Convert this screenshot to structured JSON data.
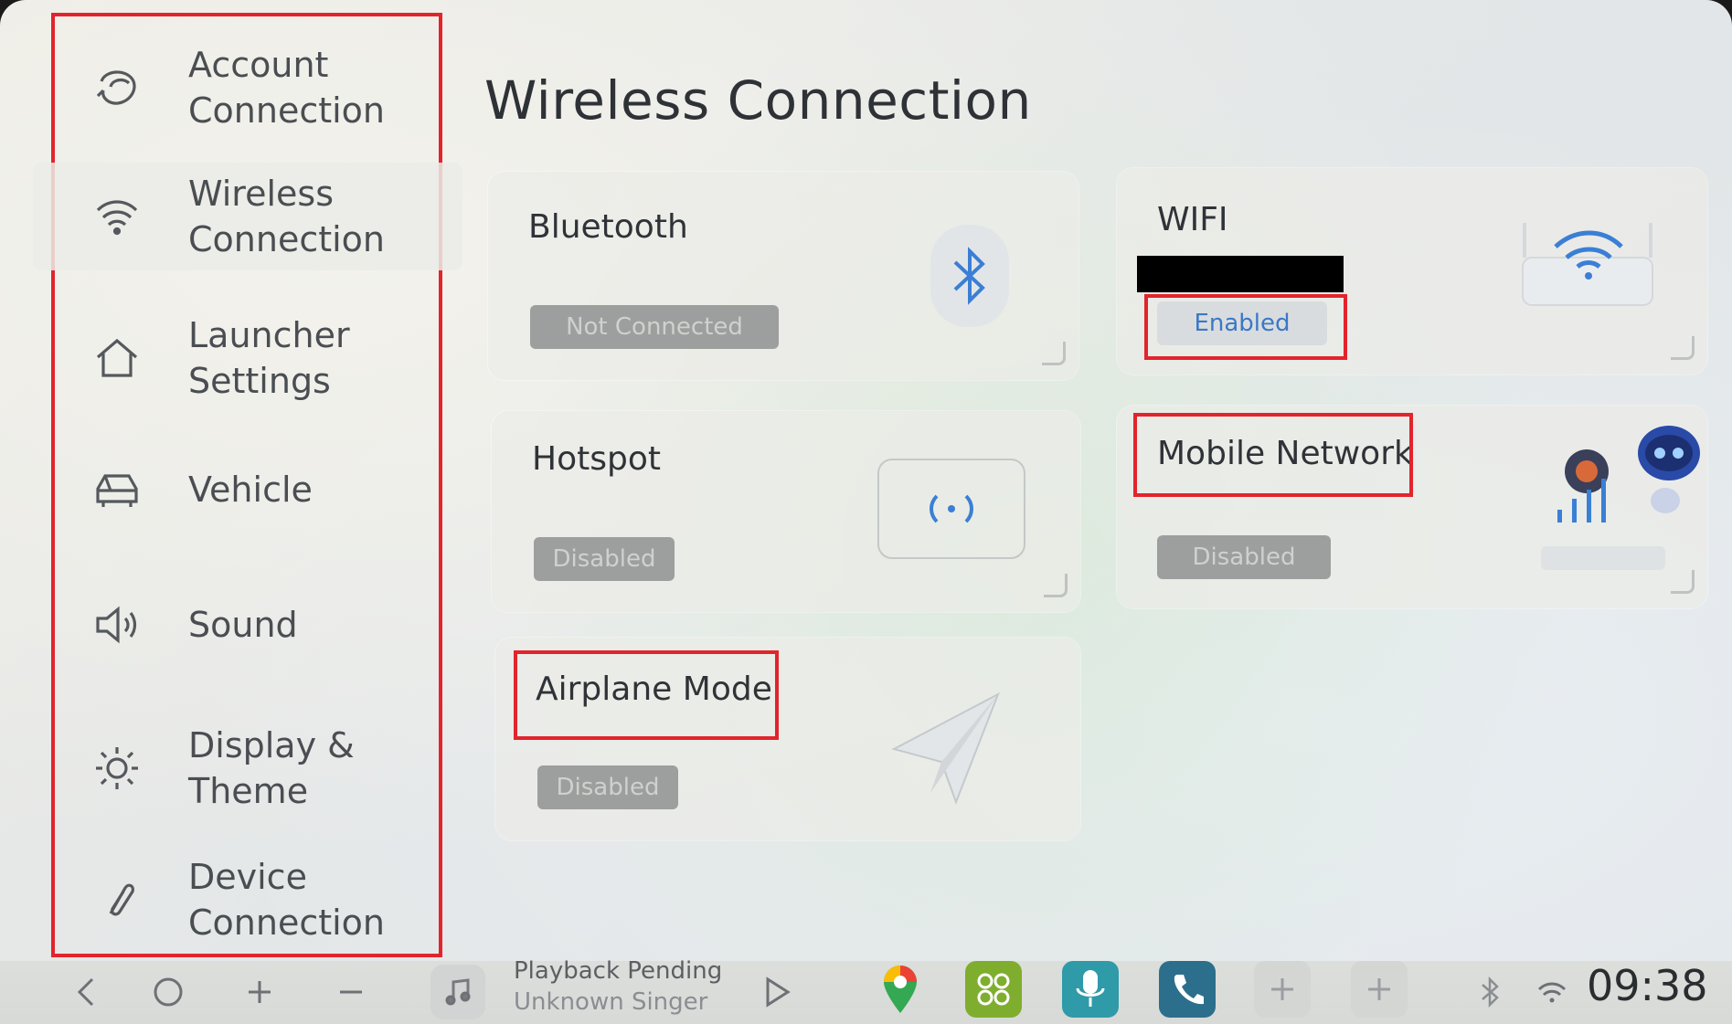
{
  "sidebar": {
    "items": [
      {
        "label": "Account\nConnection",
        "icon": "account-icon"
      },
      {
        "label": "Wireless\nConnection",
        "icon": "wifi-icon"
      },
      {
        "label": "Launcher\nSettings",
        "icon": "home-icon"
      },
      {
        "label": "Vehicle",
        "icon": "car-icon"
      },
      {
        "label": "Sound",
        "icon": "speaker-icon"
      },
      {
        "label": "Display &\nTheme",
        "icon": "sun-icon"
      },
      {
        "label": "Device\nConnection",
        "icon": "link-icon"
      }
    ]
  },
  "main": {
    "title": "Wireless Connection",
    "cards": {
      "bluetooth": {
        "title": "Bluetooth",
        "status": "Not Connected",
        "icon": "bluetooth-icon"
      },
      "wifi": {
        "title": "WIFI",
        "status": "Enabled",
        "icon": "wifi-router-icon"
      },
      "hotspot": {
        "title": "Hotspot",
        "status": "Disabled",
        "icon": "hotspot-icon"
      },
      "mobile": {
        "title": "Mobile Network",
        "status": "Disabled",
        "icon": "mobile-signal-icon"
      },
      "airplane": {
        "title": "Airplane Mode",
        "status": "Disabled",
        "icon": "paper-plane-icon"
      }
    }
  },
  "bottombar": {
    "media_title": "Playback Pending",
    "media_artist": "Unknown Singer",
    "clock": "09:38"
  },
  "colors": {
    "highlight": "#e2242c",
    "enabled_text": "#3b78c6",
    "accent_blue": "#3a7fd5"
  }
}
